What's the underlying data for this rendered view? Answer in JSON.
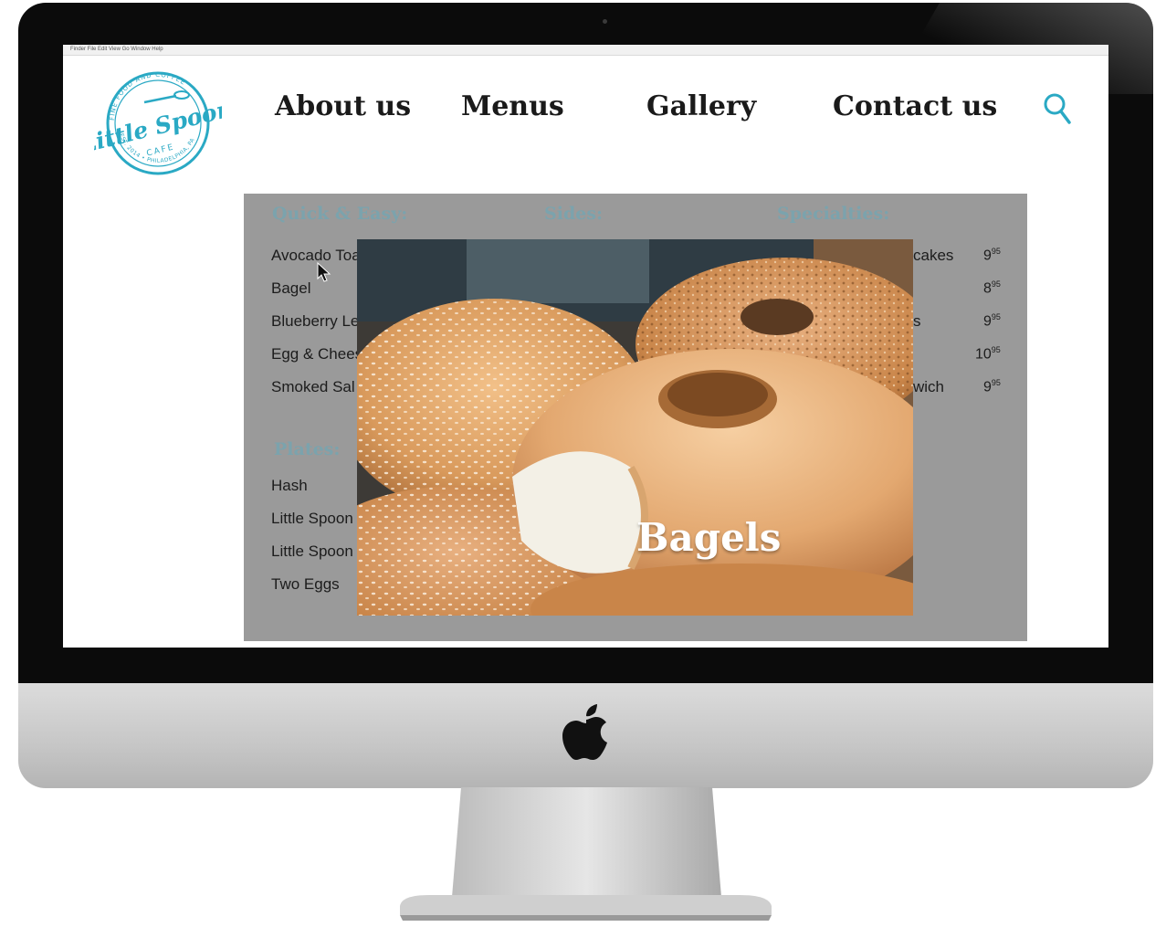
{
  "brand": {
    "logo_script": "Little Spoon",
    "logo_sub": "CAFE",
    "logo_ring": "FINE FOOD AND COFFEE",
    "logo_est": "EST. 2014 • PHILADELPHIA, PA"
  },
  "nav": {
    "about": "About us",
    "menus": "Menus",
    "gallery": "Gallery",
    "contact": "Contact us",
    "search_icon": "search-icon"
  },
  "menu": {
    "categories": {
      "quick": "Quick & Easy:",
      "sides": "Sides:",
      "specialties": "Specialties:",
      "plates": "Plates:"
    },
    "quick_items": [
      "Avocado Toa",
      "Bagel",
      "Blueberry Le",
      "Egg & Chees",
      "Smoked Sal"
    ],
    "plate_items": [
      "Hash",
      "Little Spoon",
      "Little Spoon",
      "Two Eggs"
    ],
    "specialty_tails": [
      "cakes",
      "",
      "s",
      "",
      "wich"
    ],
    "prices": [
      {
        "main": "9",
        "cents": "95"
      },
      {
        "main": "8",
        "cents": "95"
      },
      {
        "main": "9",
        "cents": "95"
      },
      {
        "main": "10",
        "cents": "95"
      },
      {
        "main": "9",
        "cents": "95"
      }
    ]
  },
  "photo": {
    "caption": "Bagels"
  },
  "colors": {
    "accent": "#2aa9c4",
    "panel": "#9a9a9a",
    "category": "#7ba3ad"
  }
}
